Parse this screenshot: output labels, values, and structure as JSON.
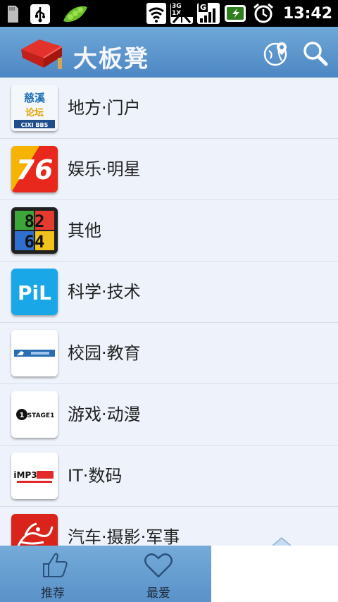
{
  "status_bar": {
    "time": "13:42",
    "net_badge": "3G 1X",
    "signal_badge": "G"
  },
  "app_bar": {
    "title": "大板凳"
  },
  "categories": [
    {
      "label": "地方·门户",
      "thumb_text_1": "慈溪",
      "thumb_text_2": "论坛",
      "thumb_text_3": "CIXI BBS"
    },
    {
      "label": "娱乐·明星",
      "thumb_text_1": "76"
    },
    {
      "label": "其他",
      "thumb_text_1": "82",
      "thumb_text_2": "64"
    },
    {
      "label": "科学·技术",
      "thumb_text_1": "PiL"
    },
    {
      "label": "校园·教育"
    },
    {
      "label": "游戏·动漫",
      "thumb_text_1": "STAGE1"
    },
    {
      "label": "IT·数码",
      "thumb_text_1": "iMP3"
    },
    {
      "label": "汽车·摄影·军事"
    }
  ],
  "bottom_nav": {
    "tabs": [
      {
        "label": "推荐"
      },
      {
        "label": "最爱"
      }
    ]
  }
}
